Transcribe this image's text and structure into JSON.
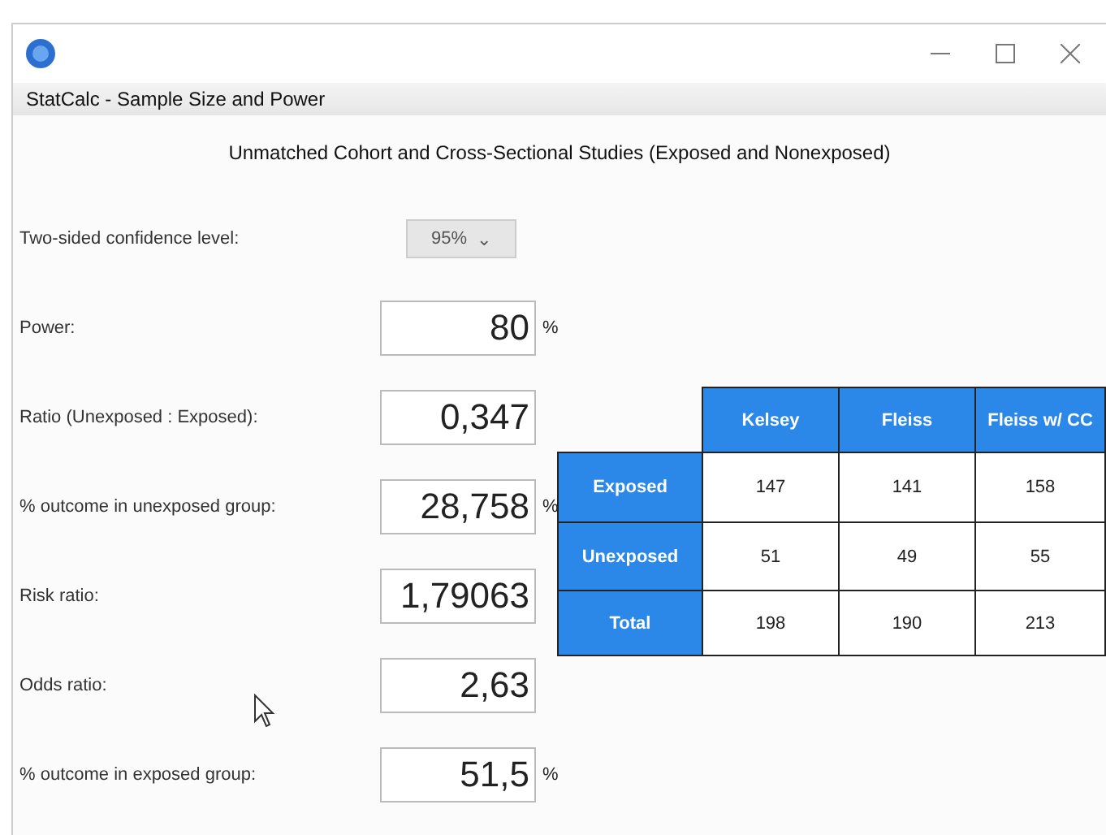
{
  "window": {
    "title": "StatCalc - Sample Size and Power"
  },
  "heading": "Unmatched Cohort and Cross-Sectional Studies (Exposed and Nonexposed)",
  "confidence": {
    "label": "Two-sided confidence level:",
    "value": "95%",
    "arrow": "⌄"
  },
  "fields": [
    {
      "label": "Power:",
      "value": "80",
      "unit": "%"
    },
    {
      "label": "Ratio (Unexposed : Exposed):",
      "value": "0,347"
    },
    {
      "label": "% outcome in unexposed group:",
      "value": "28,758",
      "unit": "%"
    },
    {
      "label": "Risk ratio:",
      "value": "1,79063"
    },
    {
      "label": "Odds ratio:",
      "value": "2,63"
    },
    {
      "label": "% outcome in exposed group:",
      "value": "51,5",
      "unit": "%"
    }
  ],
  "table": {
    "columns": [
      "Kelsey",
      "Fleiss",
      "Fleiss w/ CC"
    ],
    "rows": [
      {
        "label": "Exposed",
        "cells": [
          "147",
          "141",
          "158"
        ]
      },
      {
        "label": "Unexposed",
        "cells": [
          "51",
          "49",
          "55"
        ]
      },
      {
        "label": "Total",
        "cells": [
          "198",
          "190",
          "213"
        ]
      }
    ]
  }
}
